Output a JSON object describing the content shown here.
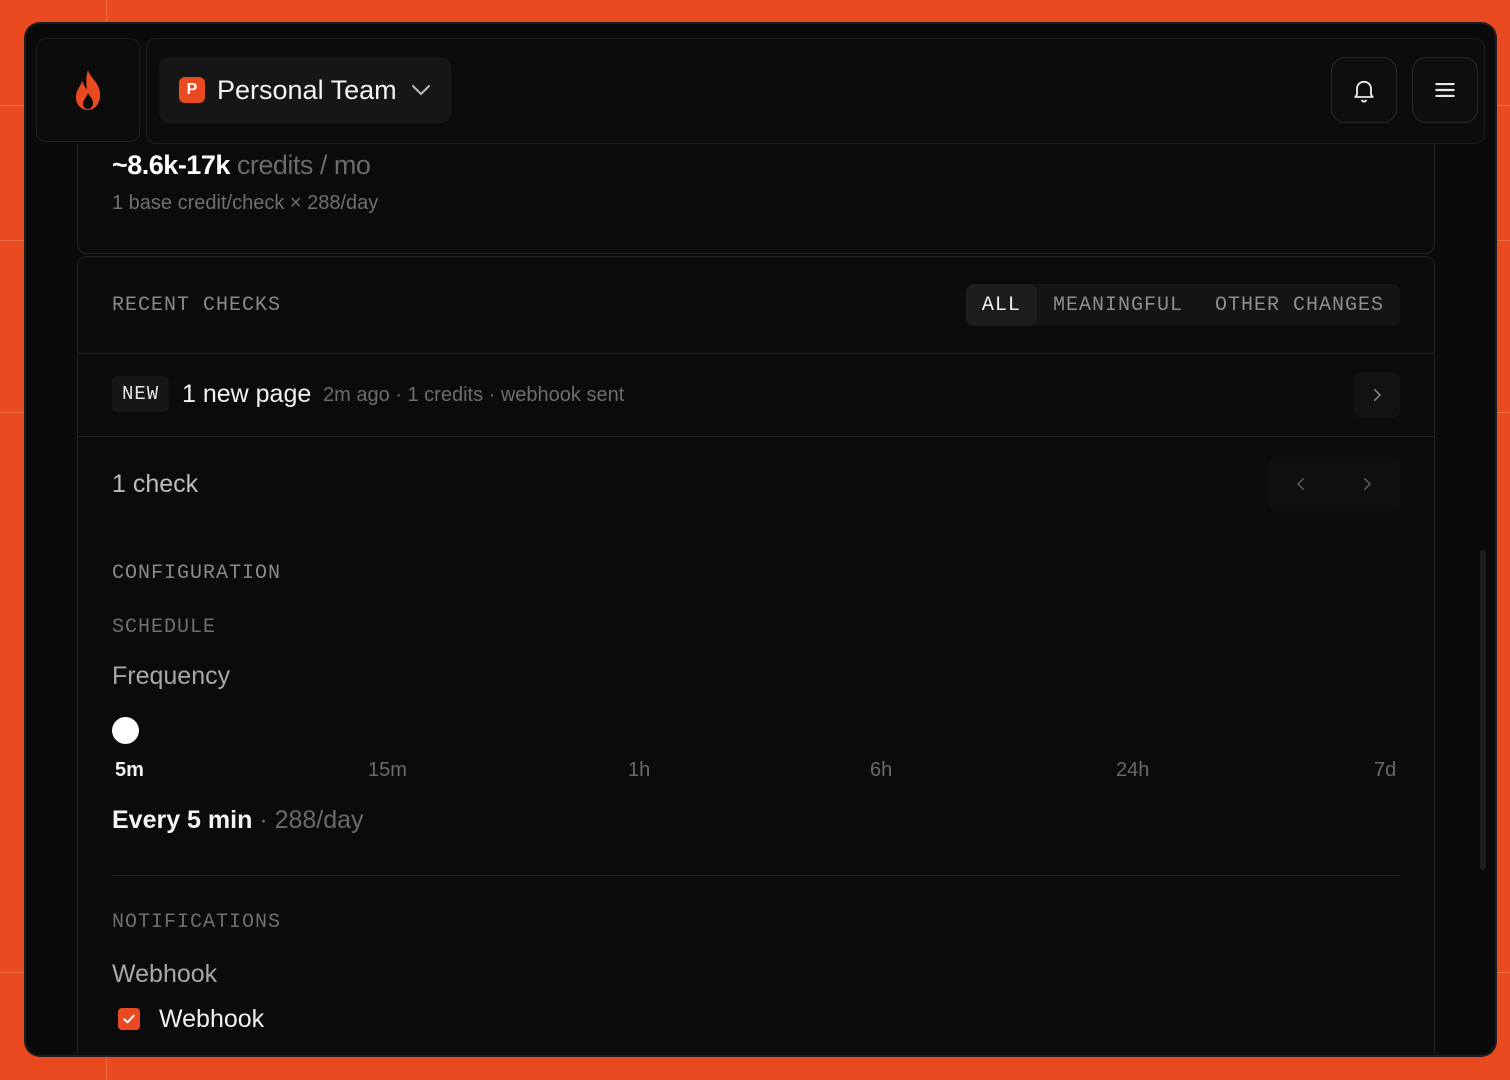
{
  "header": {
    "team_badge": "P",
    "team_name": "Personal Team"
  },
  "credits": {
    "amount": "~8.6k-17k",
    "unit": "credits / mo",
    "note": "1 base credit/check × 288/day"
  },
  "recent_checks": {
    "title": "RECENT CHECKS",
    "filters": [
      {
        "label": "ALL",
        "active": true
      },
      {
        "label": "MEANINGFUL",
        "active": false
      },
      {
        "label": "OTHER CHANGES",
        "active": false
      }
    ],
    "items": [
      {
        "badge": "NEW",
        "title": "1 new page",
        "meta": "2m ago · 1 credits · webhook sent"
      }
    ],
    "count_label": "1 check"
  },
  "configuration": {
    "title": "CONFIGURATION",
    "schedule": {
      "title": "SCHEDULE",
      "frequency_label": "Frequency",
      "options": [
        "5m",
        "15m",
        "1h",
        "6h",
        "24h",
        "7d"
      ],
      "selected_index": 0,
      "summary_main": "Every 5 min",
      "summary_sub": "· 288/day"
    },
    "notifications": {
      "title": "NOTIFICATIONS",
      "webhook_heading": "Webhook",
      "webhook_checkbox_label": "Webhook",
      "webhook_checked": true
    }
  },
  "colors": {
    "accent": "#ea4a1f",
    "window_bg": "#0a0a0a"
  }
}
